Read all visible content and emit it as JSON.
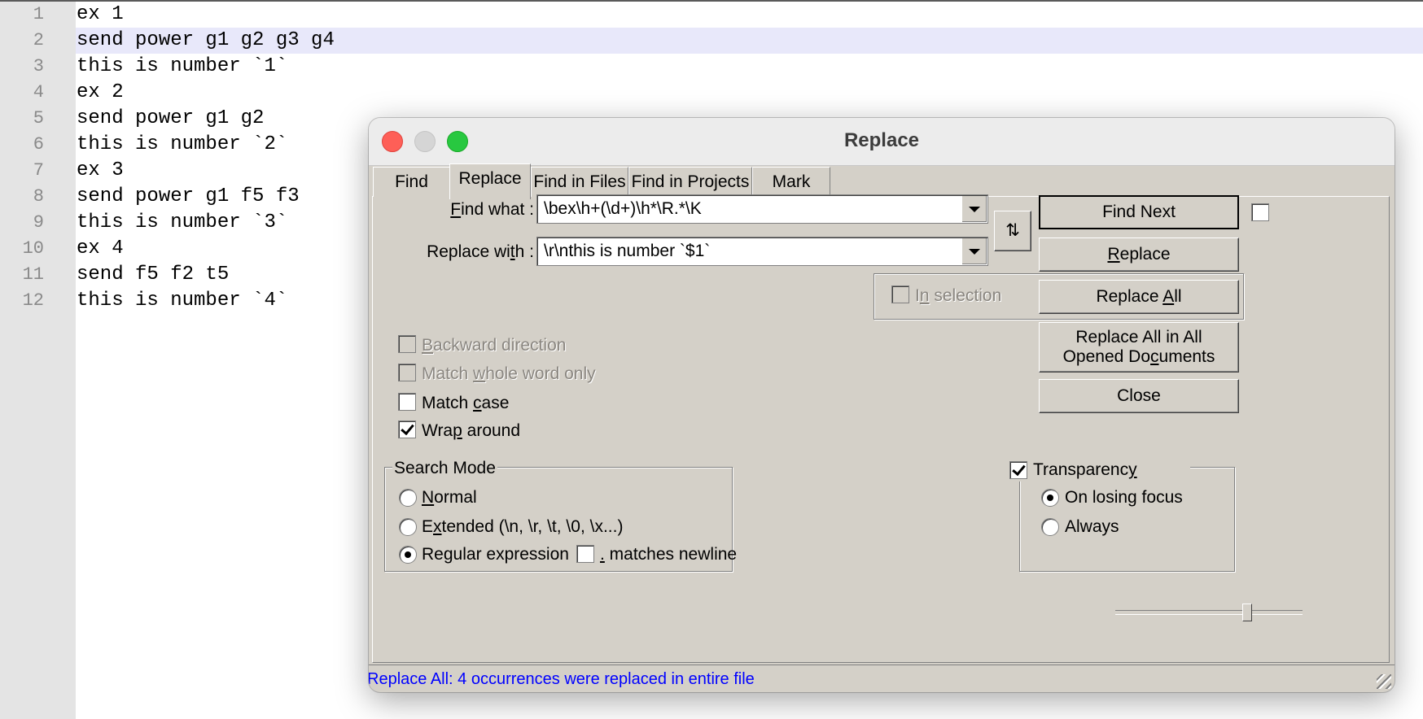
{
  "editor": {
    "highlighted_line": 2,
    "lines": [
      {
        "num": "1",
        "text": "ex 1"
      },
      {
        "num": "2",
        "text": "send power g1 g2 g3 g4"
      },
      {
        "num": "3",
        "text": "this is number `1`"
      },
      {
        "num": "4",
        "text": "ex 2"
      },
      {
        "num": "5",
        "text": "send power g1 g2"
      },
      {
        "num": "6",
        "text": "this is number `2`"
      },
      {
        "num": "7",
        "text": "ex 3"
      },
      {
        "num": "8",
        "text": "send power g1 f5 f3"
      },
      {
        "num": "9",
        "text": "this is number `3`"
      },
      {
        "num": "10",
        "text": "ex 4"
      },
      {
        "num": "11",
        "text": "send f5 f2 t5"
      },
      {
        "num": "12",
        "text": "this is number `4`"
      }
    ]
  },
  "dialog": {
    "title": "Replace",
    "tabs": [
      "Find",
      "Replace",
      "Find in Files",
      "Find in Projects",
      "Mark"
    ],
    "active_tab": "Replace",
    "find_what_label": "Find what :",
    "find_what_value": "\\bex\\h+(\\d+)\\h*\\R.*\\K",
    "replace_with_label": "Replace with :",
    "replace_with_value": "\\r\\nthis is number `$1`",
    "swap_button": "⇅",
    "buttons": {
      "find_next": "Find Next",
      "replace": "Replace",
      "replace_all": "Replace All",
      "replace_all_docs_line1": "Replace All in All",
      "replace_all_docs_line2": "Opened Documents",
      "close": "Close"
    },
    "in_selection": {
      "label": "In selection",
      "checked": false,
      "enabled": false
    },
    "options": {
      "backward_direction": {
        "label": "Backward direction",
        "checked": false,
        "enabled": false
      },
      "match_whole_word": {
        "label": "Match whole word only",
        "checked": false,
        "enabled": false
      },
      "match_case": {
        "label": "Match case",
        "checked": false
      },
      "wrap_around": {
        "label": "Wrap around",
        "checked": true
      }
    },
    "search_mode": {
      "title": "Search Mode",
      "normal": "Normal",
      "extended": "Extended (\\n, \\r, \\t, \\0, \\x...)",
      "regex": "Regular expression",
      "selected": "regex",
      "matches_newline": {
        "label": ". matches newline",
        "checked": false
      }
    },
    "transparency": {
      "title": "Transparency",
      "enabled": true,
      "on_losing_focus": "On losing focus",
      "always": "Always",
      "selected": "on_losing_focus",
      "level": 0.7
    },
    "status": "Replace All: 4 occurrences were replaced in entire file"
  }
}
